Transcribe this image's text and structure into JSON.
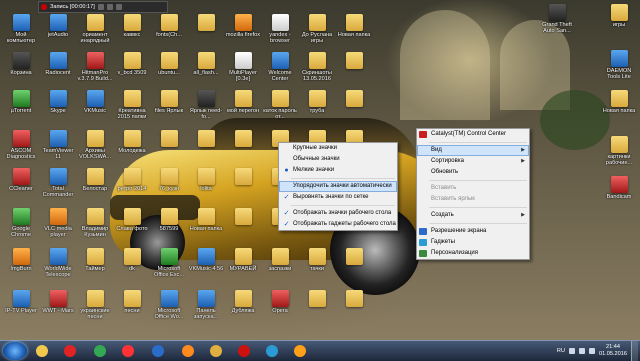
{
  "recorder": {
    "title": "Запись [00:00:17]"
  },
  "icons": [
    {
      "label": "Мой компьютер",
      "style": "blue"
    },
    {
      "label": "jetAudio",
      "style": "blue"
    },
    {
      "label": "ориамент инарядный",
      "style": "folder"
    },
    {
      "label": "каввкс",
      "style": "folder"
    },
    {
      "label": "fonts(Ch...",
      "style": "folder"
    },
    {
      "label": "",
      "style": "folder"
    },
    {
      "label": "mozilla firefox",
      "style": "orange"
    },
    {
      "label": "yandex - browser",
      "style": "white"
    },
    {
      "label": "До Руслана игры",
      "style": "folder"
    },
    {
      "label": "Новая папка",
      "style": "folder"
    },
    {
      "label": "Корзина",
      "style": "dark"
    },
    {
      "label": "Radiocent",
      "style": "blue"
    },
    {
      "label": "HitmanPro v.3.7.9 Build...",
      "style": "red"
    },
    {
      "label": "v_bcd 3509",
      "style": "folder"
    },
    {
      "label": "ubuntu...",
      "style": "folder"
    },
    {
      "label": "all_flash...",
      "style": "folder"
    },
    {
      "label": "MultiPlayer [0.3e]",
      "style": "white"
    },
    {
      "label": "Welcome Center",
      "style": "blue"
    },
    {
      "label": "Скриншоты 13.05.2016",
      "style": "folder"
    },
    {
      "label": "",
      "style": "folder"
    },
    {
      "label": "µTorrent",
      "style": "green"
    },
    {
      "label": "Skype",
      "style": "blue"
    },
    {
      "label": "VKMusic",
      "style": "blue"
    },
    {
      "label": "Креативна 2015 папки",
      "style": "folder"
    },
    {
      "label": "files Ярлык",
      "style": "folder"
    },
    {
      "label": "Ярлык need-fo...",
      "style": "dark"
    },
    {
      "label": "мой перегон",
      "style": "folder"
    },
    {
      "label": "каток пароль от...",
      "style": "folder"
    },
    {
      "label": "труба",
      "style": "folder"
    },
    {
      "label": "",
      "style": "folder"
    },
    {
      "label": "ASCOM Diagnostics",
      "style": "red"
    },
    {
      "label": "TeamViewer 11",
      "style": "blue"
    },
    {
      "label": "Архивы VOLKSWA...",
      "style": "folder"
    },
    {
      "label": "Молодежа",
      "style": "folder"
    },
    {
      "label": "",
      "style": "folder"
    },
    {
      "label": "",
      "style": "folder"
    },
    {
      "label": "",
      "style": "folder"
    },
    {
      "label": "",
      "style": "folder"
    },
    {
      "label": "",
      "style": "folder"
    },
    {
      "label": "",
      "style": "folder"
    },
    {
      "label": "CCleaner",
      "style": "red"
    },
    {
      "label": "Total Commander",
      "style": "blue"
    },
    {
      "label": "Белостар",
      "style": "folder"
    },
    {
      "label": "ретро 2014",
      "style": "folder"
    },
    {
      "label": "76_кузн",
      "style": "folder"
    },
    {
      "label": "lolita",
      "style": "folder"
    },
    {
      "label": "",
      "style": "folder"
    },
    {
      "label": "",
      "style": "folder"
    },
    {
      "label": "",
      "style": "folder"
    },
    {
      "label": "",
      "style": "folder"
    },
    {
      "label": "Google Chrome",
      "style": "green"
    },
    {
      "label": "VLC media player",
      "style": "orange"
    },
    {
      "label": "Владимир Кузьмин",
      "style": "folder"
    },
    {
      "label": "Слава фото",
      "style": "folder"
    },
    {
      "label": "587599",
      "style": "folder"
    },
    {
      "label": "Новая папка",
      "style": "folder"
    },
    {
      "label": "",
      "style": "folder"
    },
    {
      "label": "",
      "style": "folder"
    },
    {
      "label": "",
      "style": "folder"
    },
    {
      "label": "",
      "style": "folder"
    },
    {
      "label": "ImgBurn",
      "style": "orange"
    },
    {
      "label": "WorldWide Telescope",
      "style": "blue"
    },
    {
      "label": "Таймер",
      "style": "folder"
    },
    {
      "label": "dk",
      "style": "folder"
    },
    {
      "label": "Microsoft Office Exc...",
      "style": "green"
    },
    {
      "label": "VKMusic 4 56",
      "style": "blue"
    },
    {
      "label": "МУРАВЕЙ",
      "style": "folder"
    },
    {
      "label": "заcnaзки",
      "style": "folder"
    },
    {
      "label": "тачки",
      "style": "folder"
    },
    {
      "label": "",
      "style": "folder"
    },
    {
      "label": "IP-TV Player",
      "style": "blue"
    },
    {
      "label": "WWT - Mars",
      "style": "red"
    },
    {
      "label": "украинские песни",
      "style": "folder"
    },
    {
      "label": "песни",
      "style": "folder"
    },
    {
      "label": "Microsoft Office Wo...",
      "style": "blue"
    },
    {
      "label": "Панель запуска...",
      "style": "blue"
    },
    {
      "label": "Дубляжа",
      "style": "folder"
    },
    {
      "label": "Opera",
      "style": "red"
    },
    {
      "label": "",
      "style": "folder"
    },
    {
      "label": "",
      "style": "folder"
    }
  ],
  "right_icons": [
    {
      "label": "Grand Theft Auto San...",
      "style": "dark"
    },
    {
      "label": "игры",
      "style": "folder"
    },
    {
      "label": "DAEMON Tools Lite",
      "style": "blue"
    },
    {
      "label": "Новая папка",
      "style": "folder"
    },
    {
      "label": "картинки рабочие...",
      "style": "folder"
    },
    {
      "label": "Bandicam",
      "style": "red"
    }
  ],
  "view_menu": {
    "items": [
      {
        "label": "Крупные значки",
        "mark": "",
        "disabled": false
      },
      {
        "label": "Обычные значки",
        "mark": "",
        "disabled": false
      },
      {
        "label": "Мелкие значки",
        "mark": "●",
        "disabled": false
      },
      {
        "sep": true
      },
      {
        "label": "Упорядочить значки автоматически",
        "mark": "",
        "highlighted": true
      },
      {
        "label": "Выровнять значки по сетке",
        "mark": "✓"
      },
      {
        "sep": true
      },
      {
        "label": "Отображать значки рабочего стола",
        "mark": "✓"
      },
      {
        "label": "Отображать гаджеты рабочего стола",
        "mark": "✓"
      }
    ]
  },
  "context_menu": {
    "items": [
      {
        "label": "Catalyst(TM) Control Center",
        "icon": "catalyst-icon",
        "color": "#c81e1e"
      },
      {
        "sep": true
      },
      {
        "label": "Вид",
        "submenu": true,
        "highlighted": true
      },
      {
        "label": "Сортировка",
        "submenu": true
      },
      {
        "label": "Обновить"
      },
      {
        "sep": true
      },
      {
        "label": "Вставить",
        "disabled": true
      },
      {
        "label": "Вставить ярлык",
        "disabled": true
      },
      {
        "sep": true
      },
      {
        "label": "Создать",
        "submenu": true
      },
      {
        "sep": true
      },
      {
        "label": "Разрешение экрана",
        "icon": "display-icon",
        "color": "#2a6cc9"
      },
      {
        "label": "Гаджеты",
        "icon": "gadgets-icon",
        "color": "#2a9bd4"
      },
      {
        "label": "Персонализация",
        "icon": "personalize-icon",
        "color": "#3a8a3a"
      }
    ]
  },
  "taskbar": {
    "apps": [
      {
        "name": "explorer-icon",
        "color": "#f2c94c"
      },
      {
        "name": "opera-icon",
        "color": "#e02424"
      },
      {
        "name": "chrome-icon",
        "color": "#34a853"
      },
      {
        "name": "yandex-icon",
        "color": "#ff3333"
      },
      {
        "name": "radiocent-icon",
        "color": "#2a6cc9"
      },
      {
        "name": "firefox-icon",
        "color": "#ff8a1e"
      },
      {
        "name": "folder-icon",
        "color": "#e0b040"
      },
      {
        "name": "bandicam-icon",
        "color": "#cc1111"
      },
      {
        "name": "media-icon",
        "color": "#2a9bd4"
      },
      {
        "name": "paint-icon",
        "color": "#ff9f1a"
      }
    ],
    "lang": "RU",
    "time": "21:44",
    "date": "01.05.2016"
  }
}
